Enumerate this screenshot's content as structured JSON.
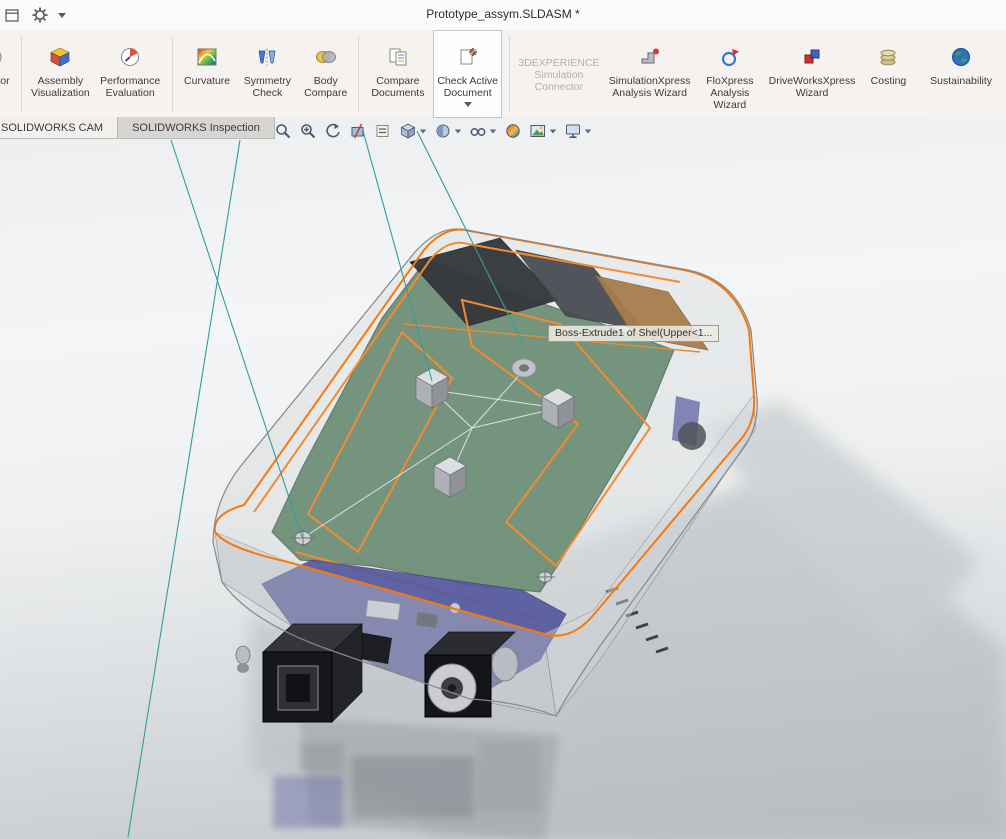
{
  "window": {
    "title": "Prototype_assym.SLDASM *"
  },
  "topbar": {
    "icons": [
      {
        "name": "window-icon"
      },
      {
        "name": "settings-gear-icon"
      },
      {
        "name": "dropdown-caret-icon"
      }
    ]
  },
  "ribbon": {
    "buttons": [
      {
        "label": "Sensor",
        "icon": "sensor-icon"
      },
      {
        "label": "Assembly Visualization",
        "icon": "assembly-visualization-icon"
      },
      {
        "label": "Performance Evaluation",
        "icon": "performance-evaluation-icon"
      },
      {
        "label": "Curvature",
        "icon": "curvature-icon"
      },
      {
        "label": "Symmetry Check",
        "icon": "symmetry-check-icon"
      },
      {
        "label": "Body Compare",
        "icon": "body-compare-icon"
      },
      {
        "label": "Compare Documents",
        "icon": "compare-documents-icon"
      },
      {
        "label": "Check Active Document",
        "icon": "check-active-document-icon",
        "active": true,
        "has_dropdown": true
      },
      {
        "label": "3DEXPERIENCE Simulation Connector",
        "icon": "",
        "disabled": true
      },
      {
        "label": "SimulationXpress Analysis Wizard",
        "icon": "simulationxpress-icon"
      },
      {
        "label": "FloXpress Analysis Wizard",
        "icon": "floxpress-icon"
      },
      {
        "label": "DriveWorksXpress Wizard",
        "icon": "driveworksxpress-icon"
      },
      {
        "label": "Costing",
        "icon": "costing-icon"
      },
      {
        "label": "Sustainability",
        "icon": "sustainability-icon"
      }
    ]
  },
  "tabs": [
    {
      "label": "SOLIDWORKS CAM"
    },
    {
      "label": "SOLIDWORKS Inspection"
    }
  ],
  "headsup": {
    "buttons": [
      {
        "icon": "zoom-to-fit-icon"
      },
      {
        "icon": "zoom-to-area-icon"
      },
      {
        "icon": "previous-view-icon"
      },
      {
        "icon": "section-view-icon"
      },
      {
        "icon": "dynamic-annotation-views-icon"
      },
      {
        "icon": "view-orientation-icon",
        "caret": true
      },
      {
        "icon": "display-style-icon",
        "caret": true
      },
      {
        "icon": "hide-show-items-icon",
        "caret": true
      },
      {
        "icon": "edit-appearance-icon"
      },
      {
        "icon": "apply-scene-icon",
        "caret": true
      },
      {
        "icon": "view-settings-icon",
        "caret": true
      }
    ]
  },
  "viewport": {
    "tooltip": "Boss-Extrude1 of Shel(Upper<1...",
    "colors": {
      "selection_orange": "#F57A0D",
      "callout_teal": "#2F9E9E",
      "pcb_green": "#5A7F63",
      "board_blue": "#3D3F8F"
    }
  }
}
